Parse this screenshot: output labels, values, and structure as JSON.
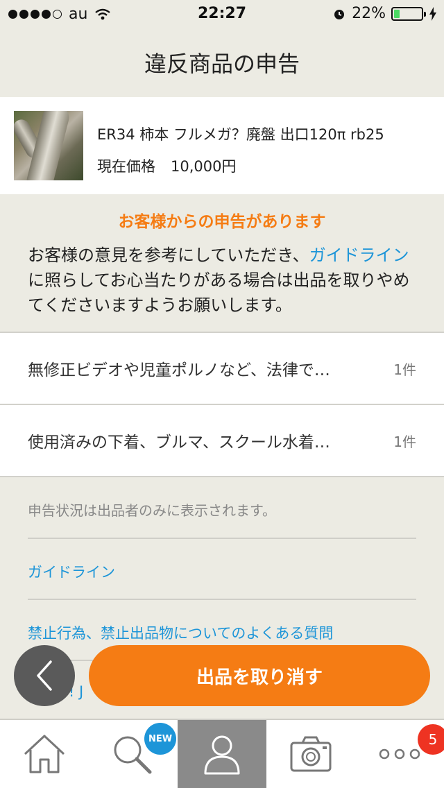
{
  "status_bar": {
    "carrier": "au",
    "time": "22:27",
    "battery": "22%",
    "battery_level": 0.22
  },
  "header": {
    "title": "違反商品の申告"
  },
  "product": {
    "title": "ER34 柿本 フルメガ？廃盤 出口120π rb25",
    "price_label": "現在価格",
    "price_value": "10,000円"
  },
  "notice": {
    "title": "お客様からの申告があります",
    "body_before": "お客様の意見を参考にしていただき、",
    "body_link": "ガイドライン",
    "body_after": "に照らしてお心当たりがある場合は出品を取りやめてくださいますようお願いします。"
  },
  "reports": [
    {
      "text": "無修正ビデオや児童ポルノなど、法律で…",
      "count": "1件"
    },
    {
      "text": "使用済みの下着、ブルマ、スクール水着…",
      "count": "1件"
    }
  ],
  "info_text": "申告状況は出品者のみに表示されます。",
  "links": {
    "guideline": "ガイドライン",
    "faq": "禁止行為、禁止出品物についてのよくある質問",
    "partial": "o! J"
  },
  "cancel_button": {
    "label": "出品を取り消す"
  },
  "tabbar": {
    "new_badge": "NEW",
    "more_badge": "5"
  },
  "colors": {
    "accent": "#f57c14",
    "link": "#1d95d8",
    "background": "#ecebe3"
  },
  "icons": [
    "signal-dots-icon",
    "wifi-icon",
    "alarm-icon",
    "charging-icon",
    "back-arrow-icon",
    "home-icon",
    "search-icon",
    "person-icon",
    "camera-icon",
    "more-icon"
  ]
}
